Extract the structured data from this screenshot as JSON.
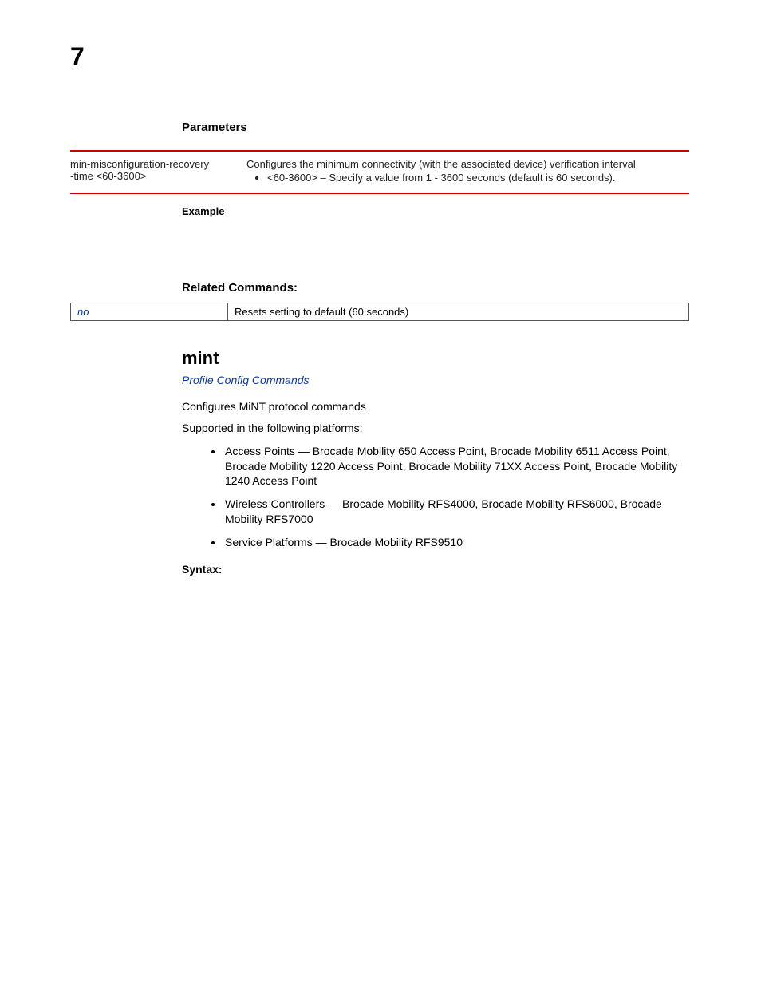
{
  "chapter_number": "7",
  "parameters": {
    "heading": "Parameters",
    "row": {
      "left_line1": "min-misconfiguration-recovery",
      "left_line2": "-time <60-3600>",
      "right_intro": "Configures the minimum connectivity (with the associated device) verification interval",
      "right_bullet": "<60-3600> – Specify a value from 1 - 3600 seconds (default is 60 seconds)."
    }
  },
  "example_heading": "Example",
  "related": {
    "heading": "Related Commands:",
    "row": {
      "cmd": "no",
      "desc": "Resets setting to default (60 seconds)"
    }
  },
  "section": {
    "title": "mint",
    "profile_link": "Profile Config Commands",
    "desc": "Configures MiNT protocol commands",
    "supported_intro": "Supported in the following platforms:",
    "platforms": {
      "ap": "Access Points — Brocade Mobility 650 Access Point, Brocade Mobility 6511 Access Point, Brocade Mobility 1220 Access Point, Brocade Mobility 71XX Access Point, Brocade Mobility 1240 Access Point",
      "wc": "Wireless Controllers — Brocade Mobility RFS4000, Brocade Mobility RFS6000, Brocade Mobility RFS7000",
      "sp": "Service Platforms — Brocade Mobility RFS9510"
    },
    "syntax_heading": "Syntax:"
  }
}
